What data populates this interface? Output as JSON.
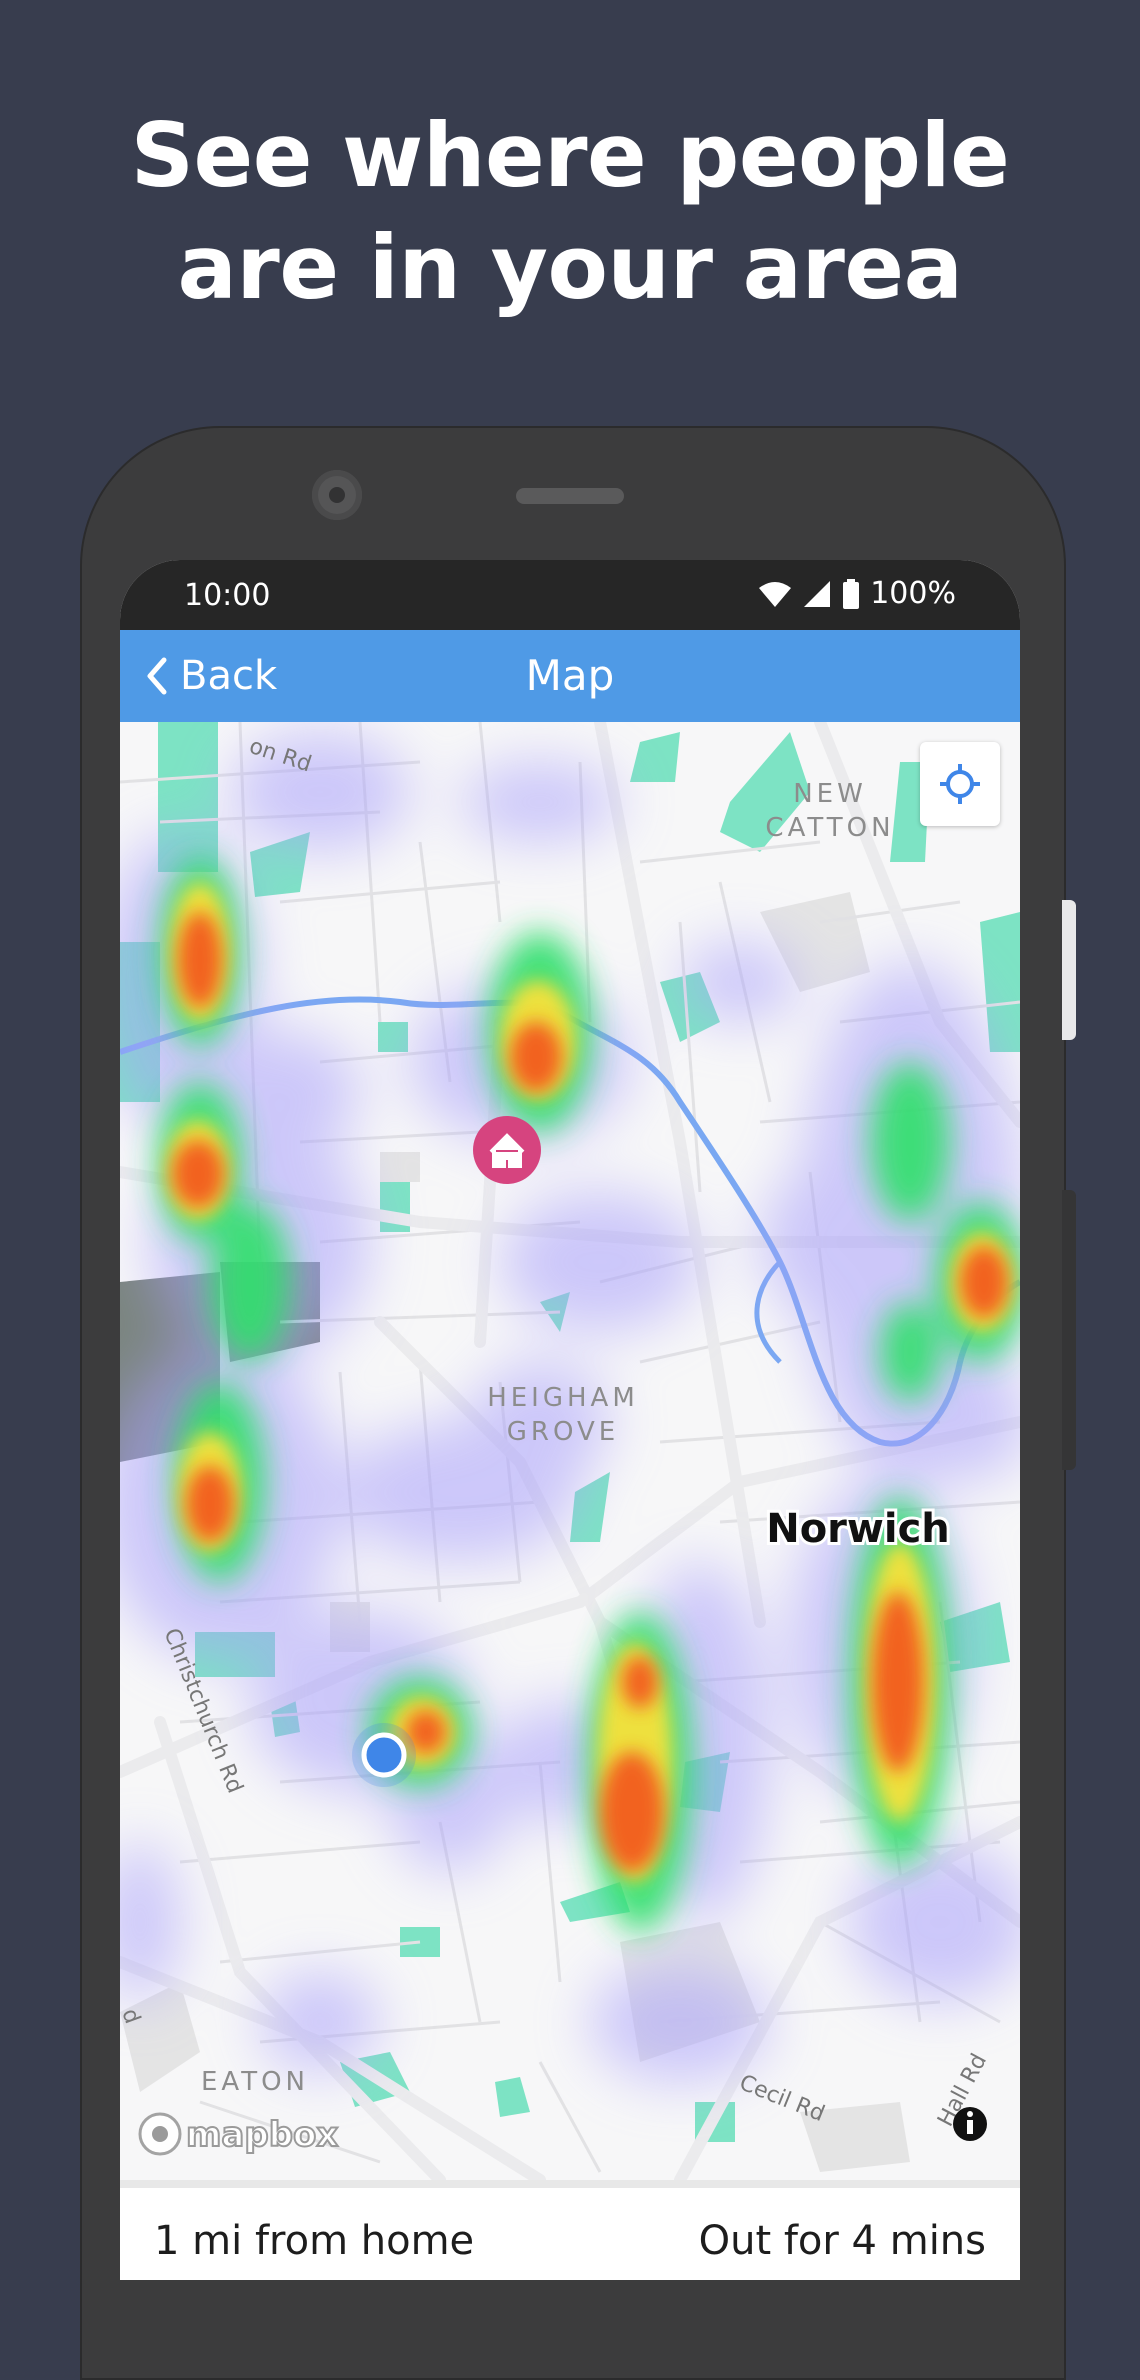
{
  "headline": {
    "line1": "See where people",
    "line2": "are in your area"
  },
  "status_bar": {
    "time": "10:00",
    "battery": "100%"
  },
  "app_bar": {
    "back_label": "Back",
    "title": "Map"
  },
  "map": {
    "places": {
      "new_catton_1": "NEW",
      "new_catton_2": "CATTON",
      "heigham_1": "HEIGHAM",
      "heigham_2": "GROVE",
      "norwich": "Norwich",
      "eaton": "EATON"
    },
    "roads": {
      "top_rd": "on Rd",
      "christchurch": "Christchurch Rd",
      "cecil": "Cecil Rd",
      "hall": "Hall Rd",
      "left_edge": "d"
    },
    "attribution": "mapbox",
    "info_icon": "info-icon"
  },
  "footer": {
    "distance": "1 mi from home",
    "duration": "Out for 4 mins"
  },
  "colors": {
    "background": "#383d4e",
    "app_bar": "#4f9ae6",
    "home_marker": "#d6447f",
    "user_dot": "#3f86e8",
    "river": "#5e9af0"
  }
}
